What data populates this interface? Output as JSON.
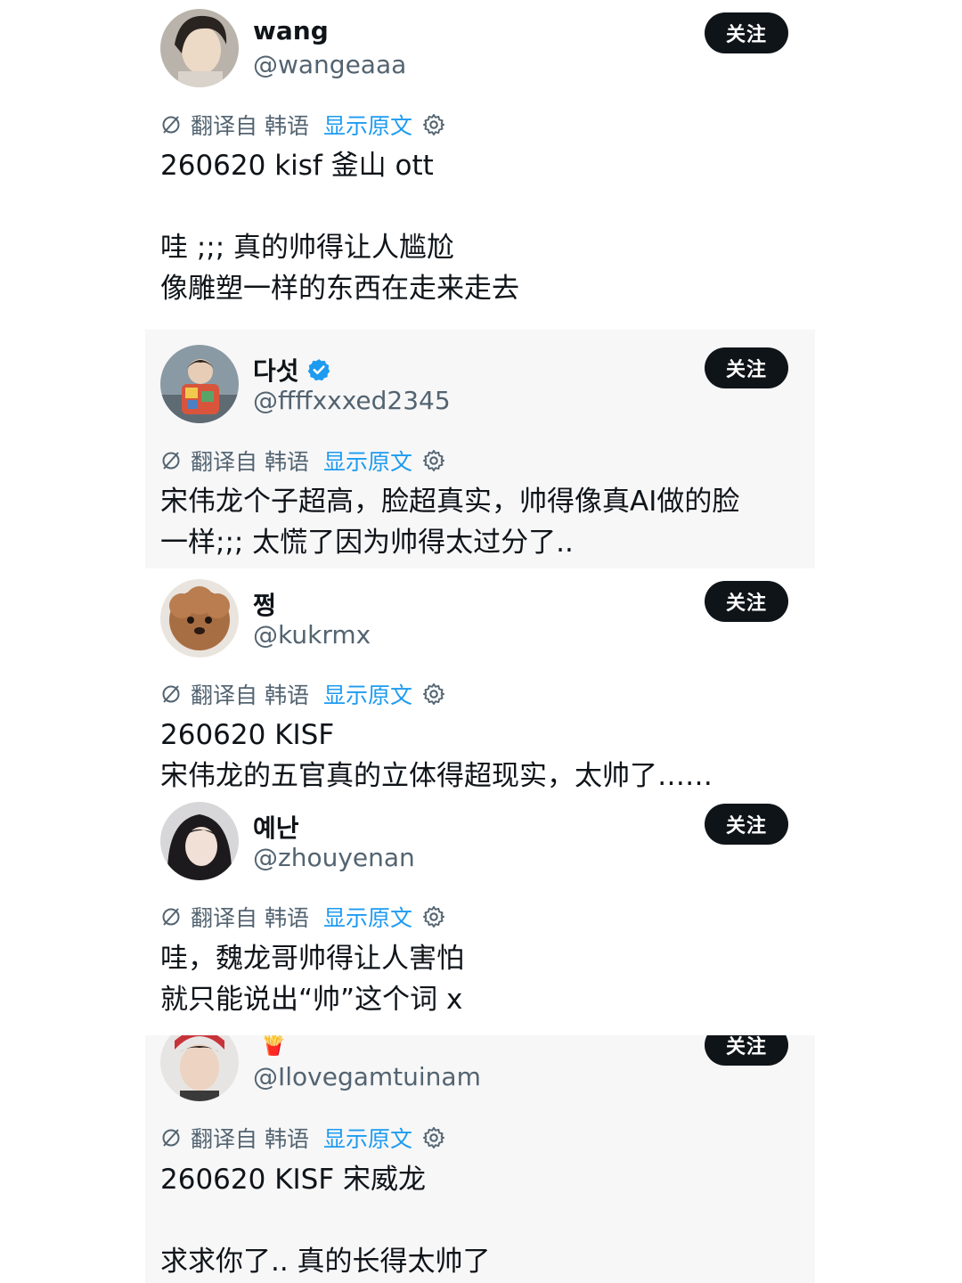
{
  "common": {
    "follow_label": "关注",
    "translated_from": "翻译自 韩语",
    "show_original": "显示原文"
  },
  "tweets": [
    {
      "display_name": "wang",
      "handle": "@wangeaaa",
      "verified": false,
      "text": "260620 kisf 釜山 ott\n\n哇 ;;; 真的帅得让人尴尬\n像雕塑一样的东西在走来走去"
    },
    {
      "display_name": "다섯",
      "handle": "@ffffxxxed2345",
      "verified": true,
      "text": "宋伟龙个子超高，脸超真实，帅得像真AI做的脸\n一样;;; 太慌了因为帅得太过分了.."
    },
    {
      "display_name": "쩡",
      "handle": "@kukrmx",
      "verified": false,
      "text": "260620 KISF\n宋伟龙的五官真的立体得超现实，太帅了……"
    },
    {
      "display_name": "예난",
      "handle": "@zhouyenan",
      "verified": false,
      "text": "哇，魏龙哥帅得让人害怕\n就只能说出“帅”这个词 x"
    },
    {
      "display_name": "",
      "handle": "@Ilovegamtuinam",
      "verified": false,
      "name_emoji": "🍟",
      "text": "260620 KISF 宋威龙\n\n求求你了.. 真的长得太帅了"
    }
  ],
  "colors": {
    "text": "#0f1419",
    "secondary": "#536471",
    "link": "#1d9bf0",
    "follow_bg": "#0f1419"
  }
}
